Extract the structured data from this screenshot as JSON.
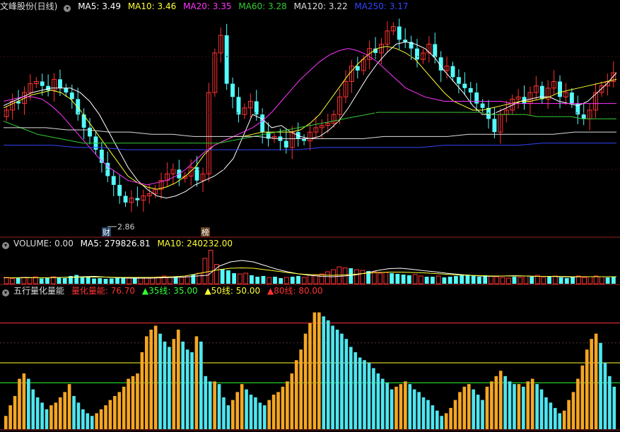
{
  "price_panel": {
    "title": "文峰股份(日线)",
    "ma": [
      {
        "label": "MA5: 3.49",
        "color": "#ffffff"
      },
      {
        "label": "MA10: 3.46",
        "color": "#ffff33"
      },
      {
        "label": "MA20: 3.35",
        "color": "#ff33ff"
      },
      {
        "label": "MA60: 3.28",
        "color": "#33cc33"
      },
      {
        "label": "MA120: 3.22",
        "color": "#dddddd"
      },
      {
        "label": "MA250: 3.17",
        "color": "#3344ff"
      }
    ],
    "low_label": "2.86",
    "marker_cai": "财",
    "marker_bang": "榜"
  },
  "volume_panel": {
    "title": "VOLUME: 0.00",
    "ma": [
      {
        "label": "MA5: 279826.81",
        "color": "#ffffff"
      },
      {
        "label": "MA10: 240232.00",
        "color": "#ffff33"
      }
    ]
  },
  "indicator_panel": {
    "title": "五行量化量能",
    "items": [
      {
        "label": "量化量能: 76.70",
        "color": "#ff3333"
      },
      {
        "label": "▲35线: 35.00",
        "color": "#33ff33"
      },
      {
        "label": "▲50线: 50.00",
        "color": "#ffff33"
      },
      {
        "label": "▲80线: 80.00",
        "color": "#ff3333"
      }
    ]
  },
  "chart_data": [
    {
      "type": "candlestick",
      "title": "文峰股份(日线)",
      "y_range": [
        2.8,
        3.75
      ],
      "annotations": [
        {
          "text": "2.86",
          "at": "low"
        }
      ],
      "closes": [
        3.32,
        3.36,
        3.35,
        3.4,
        3.44,
        3.45,
        3.43,
        3.41,
        3.46,
        3.42,
        3.4,
        3.37,
        3.3,
        3.24,
        3.2,
        3.14,
        3.08,
        3.02,
        2.98,
        2.93,
        2.9,
        2.92,
        2.91,
        2.93,
        2.94,
        2.96,
        3.0,
        3.03,
        3.05,
        3.01,
        3.02,
        3.06,
        3.0,
        3.03,
        3.4,
        3.58,
        3.66,
        3.44,
        3.38,
        3.3,
        3.33,
        3.36,
        3.3,
        3.22,
        3.19,
        3.2,
        3.18,
        3.15,
        3.22,
        3.19,
        3.18,
        3.22,
        3.24,
        3.25,
        3.26,
        3.3,
        3.38,
        3.45,
        3.52,
        3.5,
        3.55,
        3.6,
        3.58,
        3.62,
        3.68,
        3.7,
        3.64,
        3.63,
        3.6,
        3.55,
        3.58,
        3.62,
        3.56,
        3.5,
        3.52,
        3.47,
        3.44,
        3.42,
        3.4,
        3.35,
        3.33,
        3.28,
        3.22,
        3.3,
        3.32,
        3.37,
        3.38,
        3.35,
        3.4,
        3.43,
        3.37,
        3.42,
        3.45,
        3.38,
        3.4,
        3.35,
        3.3,
        3.28,
        3.32,
        3.4,
        3.43,
        3.45,
        3.49
      ],
      "series": [
        {
          "name": "MA5",
          "values": [
            3.34,
            3.36,
            3.38,
            3.4,
            3.41,
            3.42,
            3.42,
            3.42,
            3.4,
            3.36,
            3.3,
            3.22,
            3.14,
            3.06,
            3.0,
            2.96,
            2.93,
            2.92,
            2.93,
            2.95,
            2.98,
            3.0,
            3.02,
            3.05,
            3.1,
            3.2,
            3.3,
            3.28,
            3.24,
            3.25,
            3.22,
            3.2,
            3.19,
            3.2,
            3.23,
            3.27,
            3.33,
            3.4,
            3.47,
            3.53,
            3.58,
            3.62,
            3.63,
            3.62,
            3.6,
            3.56,
            3.5,
            3.45,
            3.4,
            3.34,
            3.3,
            3.3,
            3.32,
            3.34,
            3.36,
            3.37,
            3.38,
            3.38,
            3.36,
            3.35,
            3.34,
            3.36,
            3.4,
            3.44,
            3.49
          ]
        },
        {
          "name": "MA10",
          "values": [
            3.33,
            3.35,
            3.37,
            3.39,
            3.4,
            3.41,
            3.4,
            3.37,
            3.32,
            3.26,
            3.2,
            3.14,
            3.08,
            3.02,
            2.99,
            2.97,
            2.96,
            2.97,
            2.99,
            3.02,
            3.06,
            3.12,
            3.16,
            3.18,
            3.2,
            3.2,
            3.21,
            3.22,
            3.22,
            3.22,
            3.22,
            3.23,
            3.26,
            3.3,
            3.36,
            3.42,
            3.48,
            3.53,
            3.57,
            3.6,
            3.61,
            3.6,
            3.58,
            3.55,
            3.5,
            3.45,
            3.4,
            3.36,
            3.34,
            3.32,
            3.32,
            3.33,
            3.34,
            3.35,
            3.36,
            3.36,
            3.37,
            3.38,
            3.4,
            3.41,
            3.42,
            3.43,
            3.44,
            3.45,
            3.46
          ]
        },
        {
          "name": "MA20",
          "values": [
            3.36,
            3.37,
            3.38,
            3.38,
            3.37,
            3.34,
            3.3,
            3.25,
            3.2,
            3.15,
            3.1,
            3.06,
            3.03,
            3.0,
            2.99,
            2.98,
            2.99,
            3.0,
            3.02,
            3.05,
            3.09,
            3.13,
            3.16,
            3.18,
            3.2,
            3.22,
            3.24,
            3.27,
            3.31,
            3.36,
            3.41,
            3.46,
            3.5,
            3.54,
            3.57,
            3.59,
            3.6,
            3.59,
            3.57,
            3.54,
            3.5,
            3.46,
            3.42,
            3.4,
            3.38,
            3.37,
            3.36,
            3.36,
            3.36,
            3.36,
            3.36,
            3.36,
            3.36,
            3.35,
            3.35,
            3.35,
            3.35,
            3.35,
            3.35,
            3.35,
            3.35,
            3.35,
            3.35,
            3.35,
            3.35
          ]
        },
        {
          "name": "MA60",
          "values": [
            3.27,
            3.25,
            3.23,
            3.21,
            3.2,
            3.19,
            3.18,
            3.17,
            3.17,
            3.17,
            3.17,
            3.17,
            3.17,
            3.17,
            3.17,
            3.17,
            3.17,
            3.17,
            3.17,
            3.17,
            3.18,
            3.19,
            3.2,
            3.21,
            3.22,
            3.23,
            3.24,
            3.25,
            3.26,
            3.27,
            3.28,
            3.29,
            3.3,
            3.31,
            3.31,
            3.31,
            3.31,
            3.31,
            3.31,
            3.31,
            3.31,
            3.31,
            3.31,
            3.3,
            3.3,
            3.3,
            3.3,
            3.29,
            3.29,
            3.29,
            3.29,
            3.28,
            3.28,
            3.28,
            3.28
          ]
        },
        {
          "name": "MA120",
          "values": [
            3.24,
            3.24,
            3.24,
            3.23,
            3.23,
            3.22,
            3.22,
            3.21,
            3.21,
            3.2,
            3.2,
            3.2,
            3.2,
            3.19,
            3.19,
            3.19,
            3.19,
            3.19,
            3.2,
            3.2,
            3.2,
            3.2,
            3.21,
            3.21,
            3.21,
            3.21,
            3.21,
            3.22,
            3.22,
            3.22
          ]
        },
        {
          "name": "MA250",
          "values": [
            3.16,
            3.16,
            3.16,
            3.15,
            3.15,
            3.14,
            3.14,
            3.14,
            3.14,
            3.14,
            3.14,
            3.14,
            3.14,
            3.15,
            3.15,
            3.15,
            3.15,
            3.15,
            3.16,
            3.16,
            3.16,
            3.16,
            3.17,
            3.17,
            3.17,
            3.17
          ]
        }
      ]
    },
    {
      "type": "bar",
      "title": "VOLUME",
      "values": [
        0.18,
        0.15,
        0.16,
        0.18,
        0.17,
        0.2,
        0.15,
        0.16,
        0.2,
        0.18,
        0.16,
        0.22,
        0.25,
        0.2,
        0.18,
        0.15,
        0.16,
        0.14,
        0.15,
        0.18,
        0.16,
        0.17,
        0.15,
        0.16,
        0.18,
        0.17,
        0.19,
        0.22,
        0.18,
        0.2,
        0.18,
        0.2,
        0.26,
        0.3,
        0.72,
        0.95,
        0.55,
        0.42,
        0.38,
        0.3,
        0.28,
        0.3,
        0.24,
        0.2,
        0.22,
        0.18,
        0.2,
        0.16,
        0.18,
        0.2,
        0.22,
        0.18,
        0.24,
        0.26,
        0.28,
        0.34,
        0.4,
        0.48,
        0.45,
        0.44,
        0.4,
        0.38,
        0.36,
        0.34,
        0.3,
        0.32,
        0.3,
        0.28,
        0.26,
        0.24,
        0.26,
        0.22,
        0.2,
        0.2,
        0.22,
        0.18,
        0.2,
        0.22,
        0.24,
        0.26,
        0.22,
        0.2,
        0.24,
        0.22,
        0.2,
        0.18,
        0.16,
        0.2,
        0.18,
        0.22,
        0.2,
        0.24,
        0.18,
        0.2,
        0.22,
        0.18,
        0.16,
        0.2,
        0.22,
        0.18,
        0.2,
        0.22,
        0.2,
        0.18,
        0.2
      ],
      "series": [
        {
          "name": "MA5",
          "values": [
            0.17,
            0.17,
            0.18,
            0.17,
            0.17,
            0.18,
            0.19,
            0.2,
            0.21,
            0.19,
            0.17,
            0.16,
            0.16,
            0.16,
            0.17,
            0.18,
            0.19,
            0.22,
            0.24,
            0.5,
            0.62,
            0.66,
            0.62,
            0.52,
            0.42,
            0.34,
            0.28,
            0.24,
            0.21,
            0.2,
            0.22,
            0.25,
            0.31,
            0.38,
            0.43,
            0.44,
            0.41,
            0.37,
            0.34,
            0.3,
            0.27,
            0.24,
            0.22,
            0.21,
            0.22,
            0.23,
            0.22,
            0.21,
            0.21,
            0.2,
            0.19,
            0.2,
            0.2,
            0.2,
            0.2
          ]
        },
        {
          "name": "MA10",
          "values": [
            0.17,
            0.17,
            0.17,
            0.17,
            0.17,
            0.18,
            0.18,
            0.19,
            0.19,
            0.19,
            0.18,
            0.18,
            0.18,
            0.18,
            0.19,
            0.2,
            0.22,
            0.28,
            0.34,
            0.4,
            0.44,
            0.45,
            0.44,
            0.4,
            0.36,
            0.32,
            0.28,
            0.26,
            0.25,
            0.24,
            0.25,
            0.27,
            0.3,
            0.32,
            0.33,
            0.33,
            0.32,
            0.31,
            0.29,
            0.27,
            0.25,
            0.24,
            0.23,
            0.22,
            0.22,
            0.22,
            0.22,
            0.21,
            0.21,
            0.21,
            0.2,
            0.2,
            0.2,
            0.2,
            0.2
          ]
        }
      ]
    },
    {
      "type": "bar",
      "title": "五行量化量能",
      "y_range": [
        0,
        100
      ],
      "reference_lines": [
        {
          "name": "35线",
          "value": 35
        },
        {
          "name": "50线",
          "value": 50
        },
        {
          "name": "80线",
          "value": 80
        }
      ],
      "values": [
        10,
        18,
        25,
        38,
        42,
        38,
        30,
        24,
        20,
        15,
        18,
        20,
        24,
        28,
        34,
        25,
        20,
        15,
        12,
        10,
        12,
        15,
        18,
        22,
        25,
        28,
        32,
        38,
        40,
        42,
        58,
        70,
        75,
        78,
        72,
        66,
        62,
        68,
        75,
        66,
        60,
        58,
        70,
        66,
        40,
        36,
        36,
        34,
        24,
        18,
        22,
        28,
        34,
        30,
        26,
        24,
        20,
        18,
        22,
        26,
        28,
        32,
        36,
        42,
        52,
        60,
        72,
        80,
        88,
        88,
        85,
        82,
        78,
        75,
        72,
        68,
        62,
        58,
        54,
        52,
        50,
        46,
        42,
        38,
        35,
        30,
        32,
        34,
        36,
        34,
        30,
        28,
        24,
        22,
        18,
        14,
        10,
        12,
        16,
        22,
        28,
        32,
        34,
        30,
        26,
        22,
        32,
        36,
        40,
        44,
        40,
        36,
        34,
        34,
        32,
        36,
        38,
        34,
        30,
        24,
        20,
        16,
        12,
        14,
        22,
        28,
        38,
        48,
        60,
        68,
        72,
        65,
        50,
        40,
        32
      ]
    }
  ]
}
